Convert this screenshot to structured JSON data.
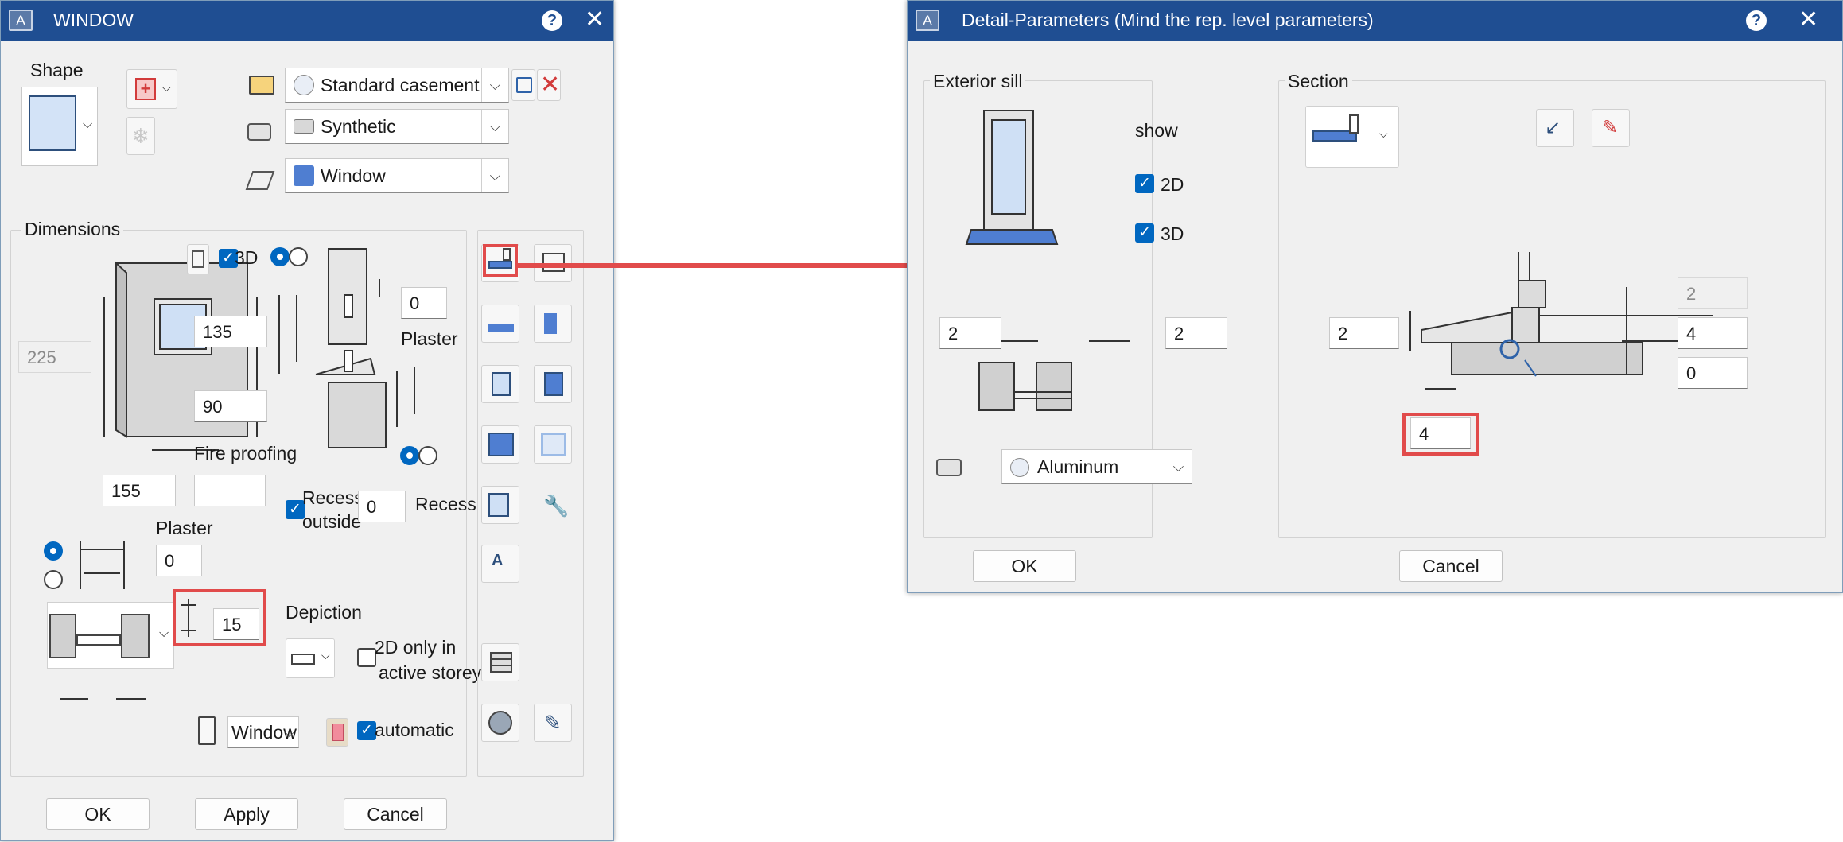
{
  "window_dialog": {
    "title": "WINDOW",
    "shape_label": "Shape",
    "profile_combo": "Standard casement",
    "material_combo": "Synthetic",
    "layer_combo": "Window",
    "dimensions_label": "Dimensions",
    "check_3d_label": "3D",
    "height_total": "225",
    "height_upper": "135",
    "height_lower": "90",
    "width": "155",
    "fire_proofing_label": "Fire proofing",
    "fire_proofing_value": "",
    "plaster_label_right": "Plaster",
    "plaster_top_value": "0",
    "plaster_label_left": "Plaster",
    "plaster_left_value": "0",
    "recess_outside_label_1": "Recess",
    "recess_outside_label_2": "outside",
    "recess_value": "0",
    "recess_label": "Recess",
    "reveal_depth_value": "15",
    "depiction_label": "Depiction",
    "only_2d_label_1": "2D only in",
    "only_2d_label_2": "active storey",
    "calc_combo": "Window",
    "automatic_label": "automatic",
    "ok": "OK",
    "apply": "Apply",
    "cancel": "Cancel"
  },
  "detail_dialog": {
    "title": "Detail-Parameters (Mind the rep. level parameters)",
    "exterior_sill_label": "Exterior sill",
    "show_label": "show",
    "check_2d_label": "2D",
    "check_3d_label": "3D",
    "sill_left_value": "2",
    "sill_right_value": "2",
    "material_combo": "Aluminum",
    "section_label": "Section",
    "section_left_value": "2",
    "section_right_disabled": "2",
    "section_right_1": "4",
    "section_right_2": "0",
    "section_bottom_value": "4",
    "ok": "OK",
    "cancel": "Cancel"
  },
  "colors": {
    "title_bar": "#1f4e92",
    "accent": "#0067c0",
    "highlight": "#e14b4b",
    "dialog_bg": "#f0f0f0"
  }
}
